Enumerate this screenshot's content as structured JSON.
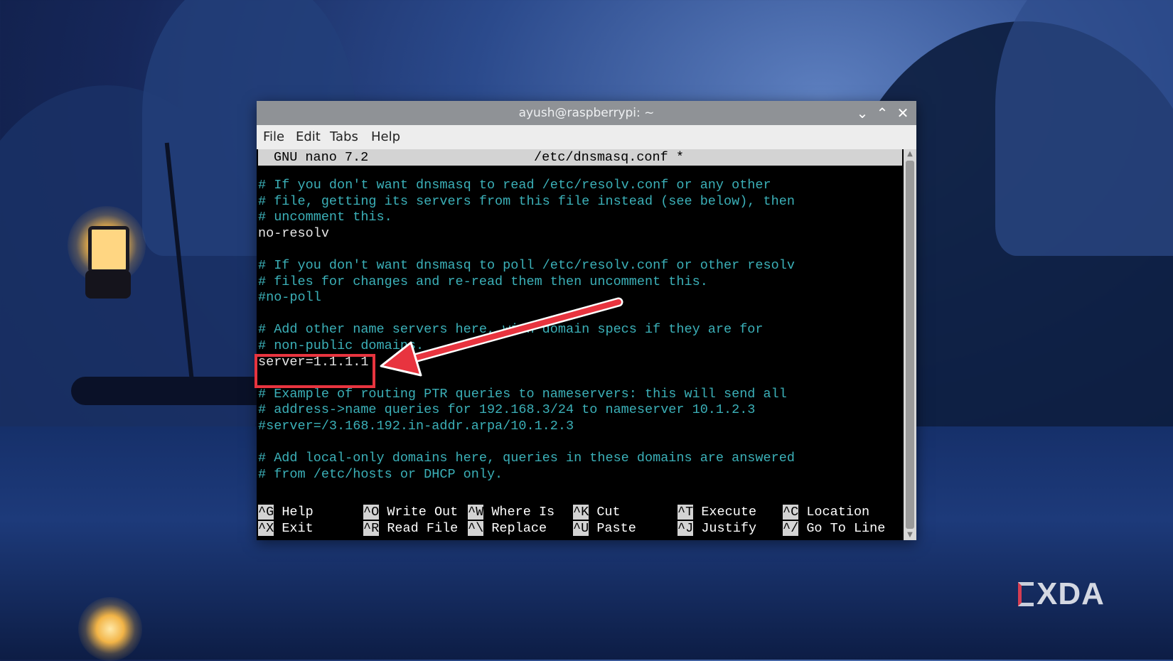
{
  "window": {
    "title": "ayush@raspberrypi: ~",
    "buttons": {
      "minimize": "⌄",
      "maximize": "⌃",
      "close": "✕"
    }
  },
  "menu": [
    "File",
    "Edit",
    "Tabs",
    "Help"
  ],
  "nano": {
    "version": "GNU nano 7.2",
    "filename": "/etc/dnsmasq.conf *"
  },
  "editor_lines": [
    {
      "text": "# If you don't want dnsmasq to read /etc/resolv.conf or any other",
      "kind": "comment"
    },
    {
      "text": "# file, getting its servers from this file instead (see below), then",
      "kind": "comment"
    },
    {
      "text": "# uncomment this.",
      "kind": "comment"
    },
    {
      "text": "no-resolv",
      "kind": "plain"
    },
    {
      "text": "",
      "kind": "plain"
    },
    {
      "text": "# If you don't want dnsmasq to poll /etc/resolv.conf or other resolv",
      "kind": "comment"
    },
    {
      "text": "# files for changes and re-read them then uncomment this.",
      "kind": "comment"
    },
    {
      "text": "#no-poll",
      "kind": "comment"
    },
    {
      "text": "",
      "kind": "plain"
    },
    {
      "text": "# Add other name servers here, with domain specs if they are for",
      "kind": "comment"
    },
    {
      "text": "# non-public domains.",
      "kind": "comment"
    },
    {
      "text": "server=1.1.1.1",
      "kind": "plain"
    },
    {
      "text": "",
      "kind": "plain"
    },
    {
      "text": "# Example of routing PTR queries to nameservers: this will send all",
      "kind": "comment"
    },
    {
      "text": "# address->name queries for 192.168.3/24 to nameserver 10.1.2.3",
      "kind": "comment"
    },
    {
      "text": "#server=/3.168.192.in-addr.arpa/10.1.2.3",
      "kind": "comment"
    },
    {
      "text": "",
      "kind": "plain"
    },
    {
      "text": "# Add local-only domains here, queries in these domains are answered",
      "kind": "comment"
    },
    {
      "text": "# from /etc/hosts or DHCP only.",
      "kind": "comment"
    }
  ],
  "shortcuts": [
    [
      {
        "key": "^G",
        "label": "Help"
      },
      {
        "key": "^O",
        "label": "Write Out"
      },
      {
        "key": "^W",
        "label": "Where Is"
      },
      {
        "key": "^K",
        "label": "Cut"
      },
      {
        "key": "^T",
        "label": "Execute"
      },
      {
        "key": "^C",
        "label": "Location"
      }
    ],
    [
      {
        "key": "^X",
        "label": "Exit"
      },
      {
        "key": "^R",
        "label": "Read File"
      },
      {
        "key": "^\\",
        "label": "Replace"
      },
      {
        "key": "^U",
        "label": "Paste"
      },
      {
        "key": "^J",
        "label": "Justify"
      },
      {
        "key": "^/",
        "label": "Go To Line"
      }
    ]
  ],
  "annotation": {
    "color": "#e8343f"
  },
  "watermark": "XDA",
  "colors": {
    "comment": "#3bb0b8",
    "titlebar": "#8f9296",
    "highlight": "#e8343f"
  }
}
